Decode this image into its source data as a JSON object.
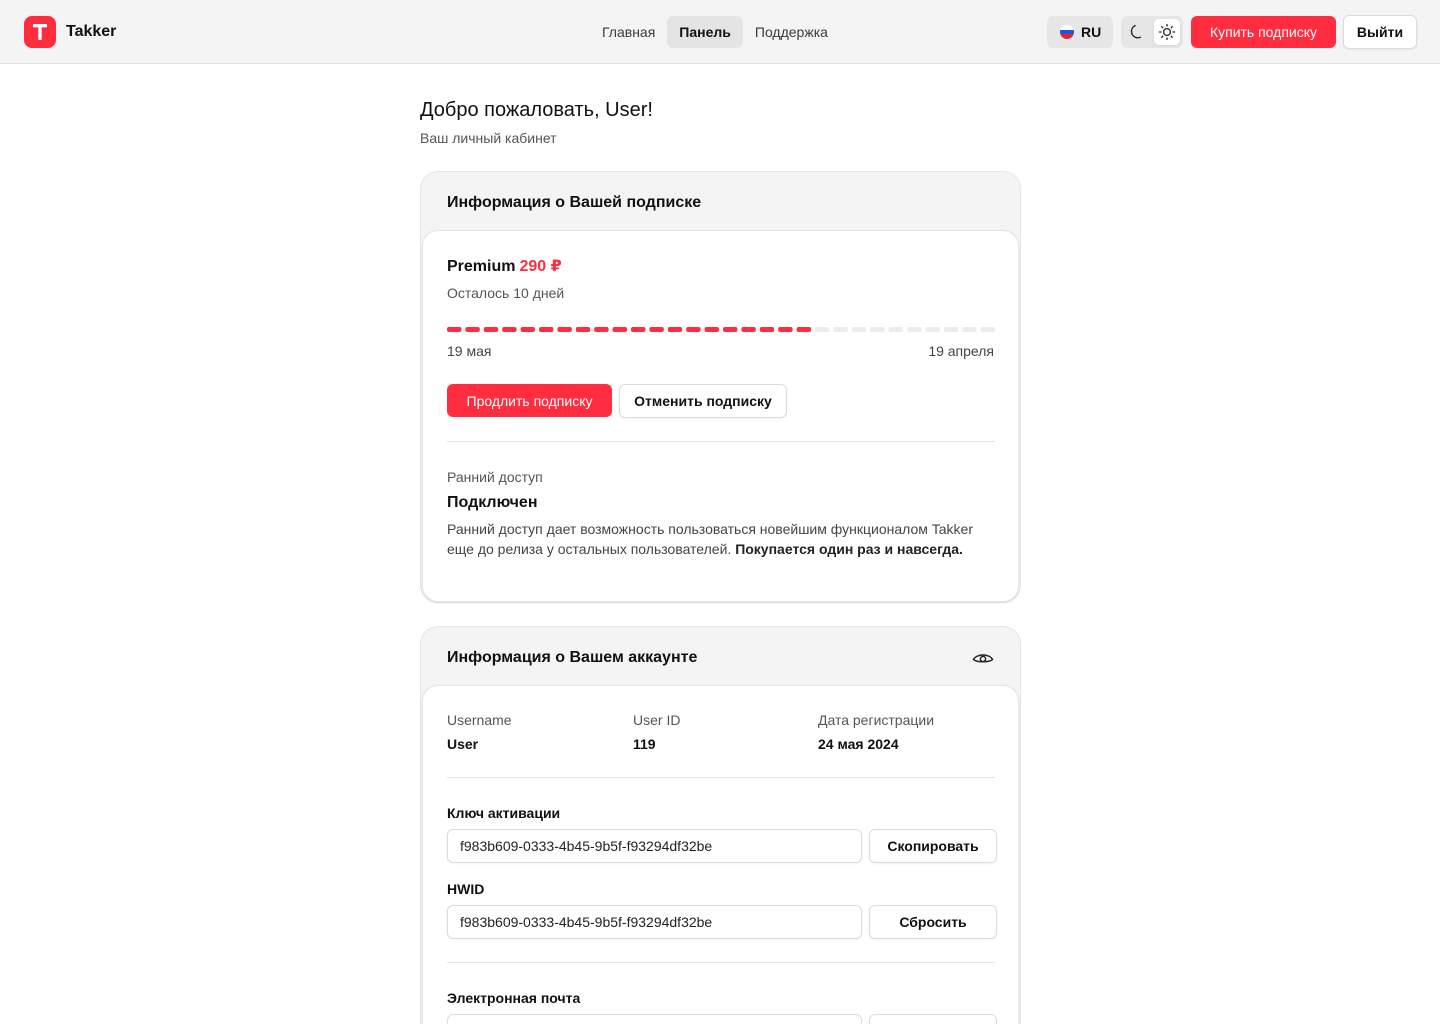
{
  "brand": {
    "name": "Takker",
    "logo_letter": "T",
    "accent": "#ff2d3f"
  },
  "nav": [
    {
      "label": "Главная",
      "active": false
    },
    {
      "label": "Панель",
      "active": true
    },
    {
      "label": "Поддержка",
      "active": false
    }
  ],
  "header": {
    "language": {
      "code": "RU",
      "flag_icon": "russia-flag-icon"
    },
    "theme": {
      "dark_icon": "moon-icon",
      "light_icon": "sun-icon",
      "selected": "light"
    },
    "buy_label": "Купить подписку",
    "logout_label": "Выйти"
  },
  "welcome": {
    "title": "Добро пожаловать, User!",
    "subtitle": "Ваш личный кабинет"
  },
  "subscription": {
    "card_title": "Информация о Вашей подписке",
    "plan_name": "Premium",
    "price": "290 ₽",
    "remaining": "Осталось 10 дней",
    "progress": {
      "segments_total": 30,
      "segments_filled": 20
    },
    "start_date": "19 мая",
    "end_date": "19 апреля",
    "renew_label": "Продлить подписку",
    "cancel_label": "Отменить подписку",
    "early_access": {
      "label": "Ранний доступ",
      "status": "Подключен",
      "description": "Ранний доступ дает возможность пользоваться новейшим функционалом Takker еще до релиза у остальных пользователей.",
      "description_bold": "Покупается один раз и навсегда."
    }
  },
  "account": {
    "card_title": "Информация о Вашем аккаунте",
    "visibility_icon": "eye-icon",
    "username_label": "Username",
    "username": "User",
    "user_id_label": "User ID",
    "user_id": "119",
    "reg_date_label": "Дата регистрации",
    "reg_date": "24 мая 2024",
    "activation_key_label": "Ключ активации",
    "activation_key": "f983b609-0333-4b45-9b5f-f93294df32be",
    "copy_label": "Скопировать",
    "hwid_label": "HWID",
    "hwid": "f983b609-0333-4b45-9b5f-f93294df32be",
    "reset_label": "Сбросить",
    "email_label": "Электронная почта"
  }
}
